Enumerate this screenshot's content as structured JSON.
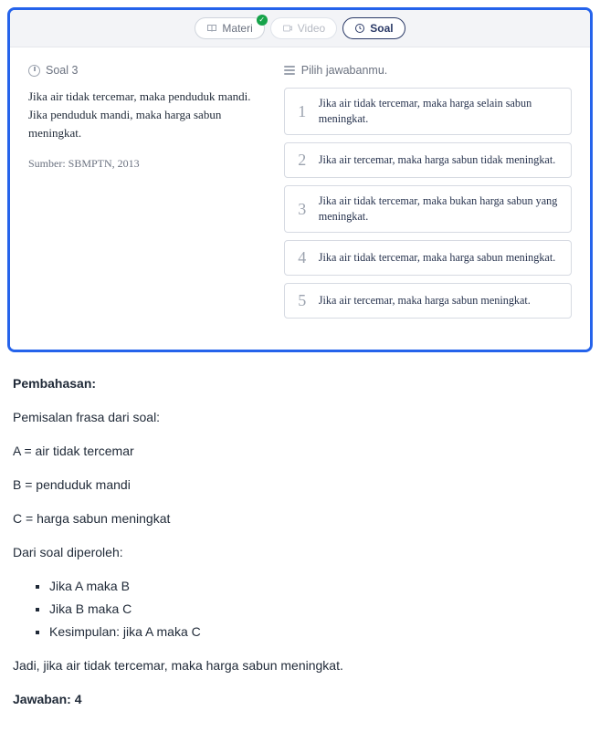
{
  "tabs": {
    "materi": "Materi",
    "video": "Video",
    "soal": "Soal"
  },
  "question": {
    "label": "Soal 3",
    "line1": "Jika air tidak tercemar, maka penduduk mandi.",
    "line2": "Jika penduduk mandi, maka harga sabun meningkat.",
    "source": "Sumber: SBMPTN, 2013"
  },
  "answer": {
    "prompt": "Pilih jawabanmu.",
    "options": [
      {
        "num": "1",
        "text": "Jika air tidak tercemar, maka harga selain sabun meningkat."
      },
      {
        "num": "2",
        "text": "Jika air tercemar, maka harga sabun tidak meningkat."
      },
      {
        "num": "3",
        "text": "Jika air tidak tercemar, maka bukan harga sabun yang meningkat."
      },
      {
        "num": "4",
        "text": "Jika air tidak tercemar, maka harga sabun meningkat."
      },
      {
        "num": "5",
        "text": "Jika air tercemar, maka harga sabun meningkat."
      }
    ]
  },
  "explanation": {
    "heading": "Pembahasan:",
    "p1": "Pemisalan frasa dari soal:",
    "a": "A = air tidak tercemar",
    "b": "B = penduduk mandi",
    "c": "C = harga sabun meningkat",
    "p2": "Dari soal diperoleh:",
    "bullets": [
      "Jika A maka B",
      "Jika B maka C",
      "Kesimpulan: jika A maka C"
    ],
    "conclusion": "Jadi, jika air tidak tercemar, maka harga sabun meningkat.",
    "answer": "Jawaban: 4"
  }
}
